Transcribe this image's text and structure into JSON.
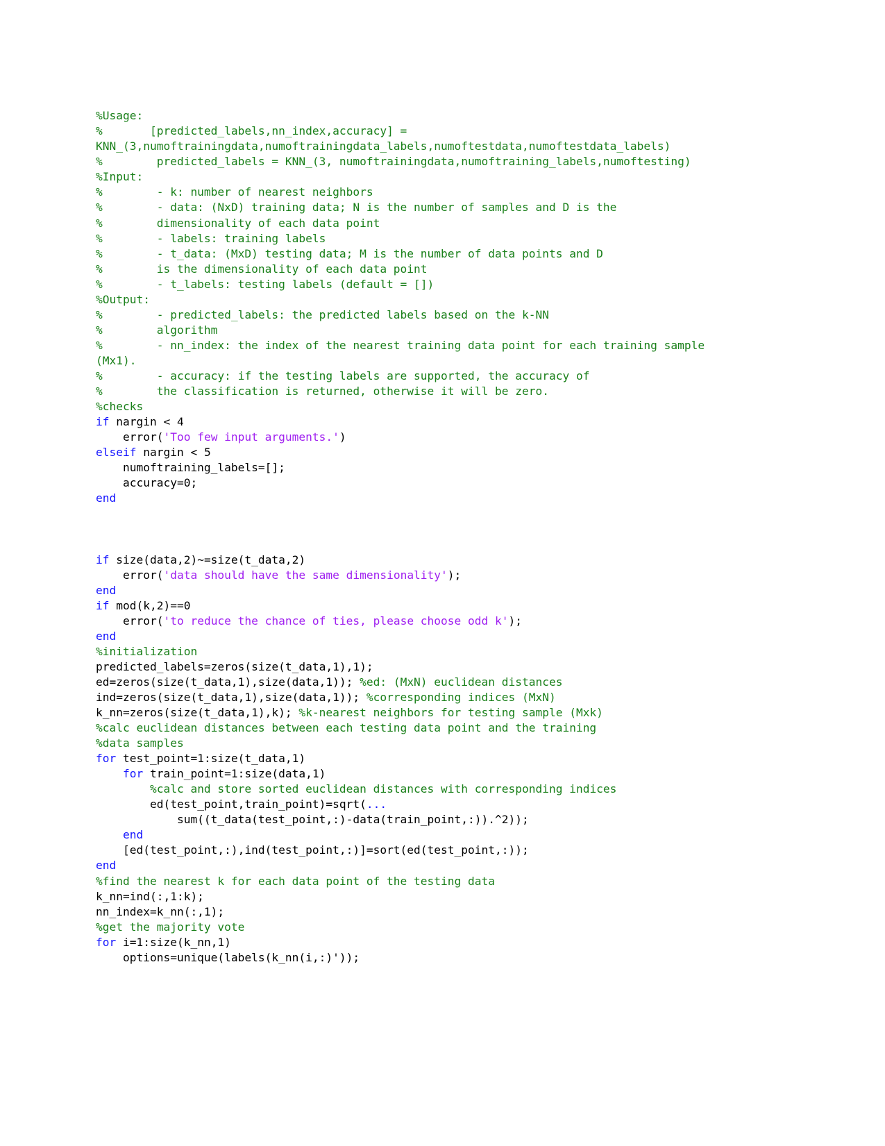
{
  "document": {
    "kind": "matlab-source-listing",
    "page_background": "#ffffff",
    "colors": {
      "comment": "#1a801a",
      "keyword": "#1414ff",
      "string": "#a020f0",
      "code": "#000000",
      "continuation": "#1414ff"
    }
  },
  "code": {
    "lines": [
      {
        "id": "l01",
        "segments": [
          {
            "cls": "cm",
            "text": "%Usage:"
          }
        ]
      },
      {
        "id": "l02",
        "segments": [
          {
            "cls": "cm",
            "text": "%       [predicted_labels,nn_index,accuracy] = KNN_(3,numoftrainingdata,numoftrainingdata_labels,numoftestdata,numoftestdata_labels)"
          }
        ]
      },
      {
        "id": "l03",
        "segments": [
          {
            "cls": "cm",
            "text": "%        predicted_labels = KNN_(3, numoftrainingdata,numoftraining_labels,numoftesting)"
          }
        ]
      },
      {
        "id": "l04",
        "segments": [
          {
            "cls": "cm",
            "text": "%Input:"
          }
        ]
      },
      {
        "id": "l05",
        "segments": [
          {
            "cls": "cm",
            "text": "%        - k: number of nearest neighbors"
          }
        ]
      },
      {
        "id": "l06",
        "segments": [
          {
            "cls": "cm",
            "text": "%        - data: (NxD) training data; N is the number of samples and D is the"
          }
        ]
      },
      {
        "id": "l07",
        "segments": [
          {
            "cls": "cm",
            "text": "%        dimensionality of each data point"
          }
        ]
      },
      {
        "id": "l08",
        "segments": [
          {
            "cls": "cm",
            "text": "%        - labels: training labels"
          }
        ]
      },
      {
        "id": "l09",
        "segments": [
          {
            "cls": "cm",
            "text": "%        - t_data: (MxD) testing data; M is the number of data points and D"
          }
        ]
      },
      {
        "id": "l10",
        "segments": [
          {
            "cls": "cm",
            "text": "%        is the dimensionality of each data point"
          }
        ]
      },
      {
        "id": "l11",
        "segments": [
          {
            "cls": "cm",
            "text": "%        - t_labels: testing labels (default = [])"
          }
        ]
      },
      {
        "id": "l12",
        "segments": [
          {
            "cls": "cm",
            "text": "%Output:"
          }
        ]
      },
      {
        "id": "l13",
        "segments": [
          {
            "cls": "cm",
            "text": "%        - predicted_labels: the predicted labels based on the k-NN"
          }
        ]
      },
      {
        "id": "l14",
        "segments": [
          {
            "cls": "cm",
            "text": "%        algorithm"
          }
        ]
      },
      {
        "id": "l15",
        "segments": [
          {
            "cls": "cm",
            "text": "%        - nn_index: the index of the nearest training data point for each training sample (Mx1)."
          }
        ]
      },
      {
        "id": "l16",
        "segments": [
          {
            "cls": "cm",
            "text": "%        - accuracy: if the testing labels are supported, the accuracy of"
          }
        ]
      },
      {
        "id": "l17",
        "segments": [
          {
            "cls": "cm",
            "text": "%        the classification is returned, otherwise it will be zero."
          }
        ]
      },
      {
        "id": "l18",
        "segments": [
          {
            "cls": "cm",
            "text": "%checks"
          }
        ]
      },
      {
        "id": "l19",
        "segments": [
          {
            "cls": "kw",
            "text": "if"
          },
          {
            "cls": "cd",
            "text": " nargin < 4"
          }
        ]
      },
      {
        "id": "l20",
        "segments": [
          {
            "cls": "cd",
            "text": "    error("
          },
          {
            "cls": "st",
            "text": "'Too few input arguments.'"
          },
          {
            "cls": "cd",
            "text": ")"
          }
        ]
      },
      {
        "id": "l21",
        "segments": [
          {
            "cls": "kw",
            "text": "elseif"
          },
          {
            "cls": "cd",
            "text": " nargin < 5"
          }
        ]
      },
      {
        "id": "l22",
        "segments": [
          {
            "cls": "cd",
            "text": "    numoftraining_labels=[];"
          }
        ]
      },
      {
        "id": "l23",
        "segments": [
          {
            "cls": "cd",
            "text": "    accuracy=0;"
          }
        ]
      },
      {
        "id": "l24",
        "segments": [
          {
            "cls": "kw",
            "text": "end"
          }
        ]
      },
      {
        "id": "l25",
        "segments": []
      },
      {
        "id": "l26",
        "segments": []
      },
      {
        "id": "l27",
        "segments": []
      },
      {
        "id": "l28",
        "segments": [
          {
            "cls": "kw",
            "text": "if"
          },
          {
            "cls": "cd",
            "text": " size(data,2)~=size(t_data,2)"
          }
        ]
      },
      {
        "id": "l29",
        "segments": [
          {
            "cls": "cd",
            "text": "    error("
          },
          {
            "cls": "st",
            "text": "'data should have the same dimensionality'"
          },
          {
            "cls": "cd",
            "text": ");"
          }
        ]
      },
      {
        "id": "l30",
        "segments": [
          {
            "cls": "kw",
            "text": "end"
          }
        ]
      },
      {
        "id": "l31",
        "segments": [
          {
            "cls": "kw",
            "text": "if"
          },
          {
            "cls": "cd",
            "text": " mod(k,2)==0"
          }
        ]
      },
      {
        "id": "l32",
        "segments": [
          {
            "cls": "cd",
            "text": "    error("
          },
          {
            "cls": "st",
            "text": "'to reduce the chance of ties, please choose odd k'"
          },
          {
            "cls": "cd",
            "text": ");"
          }
        ]
      },
      {
        "id": "l33",
        "segments": [
          {
            "cls": "kw",
            "text": "end"
          }
        ]
      },
      {
        "id": "l34",
        "segments": [
          {
            "cls": "cm",
            "text": "%initialization"
          }
        ]
      },
      {
        "id": "l35",
        "segments": [
          {
            "cls": "cd",
            "text": "predicted_labels=zeros(size(t_data,1),1);"
          }
        ]
      },
      {
        "id": "l36",
        "segments": [
          {
            "cls": "cd",
            "text": "ed=zeros(size(t_data,1),size(data,1)); "
          },
          {
            "cls": "cm",
            "text": "%ed: (MxN) euclidean distances"
          }
        ]
      },
      {
        "id": "l37",
        "segments": [
          {
            "cls": "cd",
            "text": "ind=zeros(size(t_data,1),size(data,1)); "
          },
          {
            "cls": "cm",
            "text": "%corresponding indices (MxN)"
          }
        ]
      },
      {
        "id": "l38",
        "segments": [
          {
            "cls": "cd",
            "text": "k_nn=zeros(size(t_data,1),k); "
          },
          {
            "cls": "cm",
            "text": "%k-nearest neighbors for testing sample (Mxk)"
          }
        ]
      },
      {
        "id": "l39",
        "segments": [
          {
            "cls": "cm",
            "text": "%calc euclidean distances between each testing data point and the training"
          }
        ]
      },
      {
        "id": "l40",
        "segments": [
          {
            "cls": "cm",
            "text": "%data samples"
          }
        ]
      },
      {
        "id": "l41",
        "segments": [
          {
            "cls": "kw",
            "text": "for"
          },
          {
            "cls": "cd",
            "text": " test_point=1:size(t_data,1)"
          }
        ]
      },
      {
        "id": "l42",
        "segments": [
          {
            "cls": "cd",
            "text": "    "
          },
          {
            "cls": "kw",
            "text": "for"
          },
          {
            "cls": "cd",
            "text": " train_point=1:size(data,1)"
          }
        ]
      },
      {
        "id": "l43",
        "segments": [
          {
            "cls": "cm",
            "text": "        %calc and store sorted euclidean distances with corresponding indices"
          }
        ]
      },
      {
        "id": "l44",
        "segments": [
          {
            "cls": "cd",
            "text": "        ed(test_point,train_point)=sqrt("
          },
          {
            "cls": "cont",
            "text": "..."
          }
        ]
      },
      {
        "id": "l45",
        "segments": [
          {
            "cls": "cd",
            "text": "            sum((t_data(test_point,:)-data(train_point,:)).^2));"
          }
        ]
      },
      {
        "id": "l46",
        "segments": [
          {
            "cls": "cd",
            "text": "    "
          },
          {
            "cls": "kw",
            "text": "end"
          }
        ]
      },
      {
        "id": "l47",
        "segments": [
          {
            "cls": "cd",
            "text": "    [ed(test_point,:),ind(test_point,:)]=sort(ed(test_point,:));"
          }
        ]
      },
      {
        "id": "l48",
        "segments": [
          {
            "cls": "kw",
            "text": "end"
          }
        ]
      },
      {
        "id": "l49",
        "segments": [
          {
            "cls": "cm",
            "text": "%find the nearest k for each data point of the testing data"
          }
        ]
      },
      {
        "id": "l50",
        "segments": [
          {
            "cls": "cd",
            "text": "k_nn=ind(:,1:k);"
          }
        ]
      },
      {
        "id": "l51",
        "segments": [
          {
            "cls": "cd",
            "text": "nn_index=k_nn(:,1);"
          }
        ]
      },
      {
        "id": "l52",
        "segments": [
          {
            "cls": "cm",
            "text": "%get the majority vote"
          }
        ]
      },
      {
        "id": "l53",
        "segments": [
          {
            "cls": "kw",
            "text": "for"
          },
          {
            "cls": "cd",
            "text": " i=1:size(k_nn,1)"
          }
        ]
      },
      {
        "id": "l54",
        "segments": [
          {
            "cls": "cd",
            "text": "    options=unique(labels(k_nn(i,:)'));"
          }
        ]
      }
    ]
  }
}
